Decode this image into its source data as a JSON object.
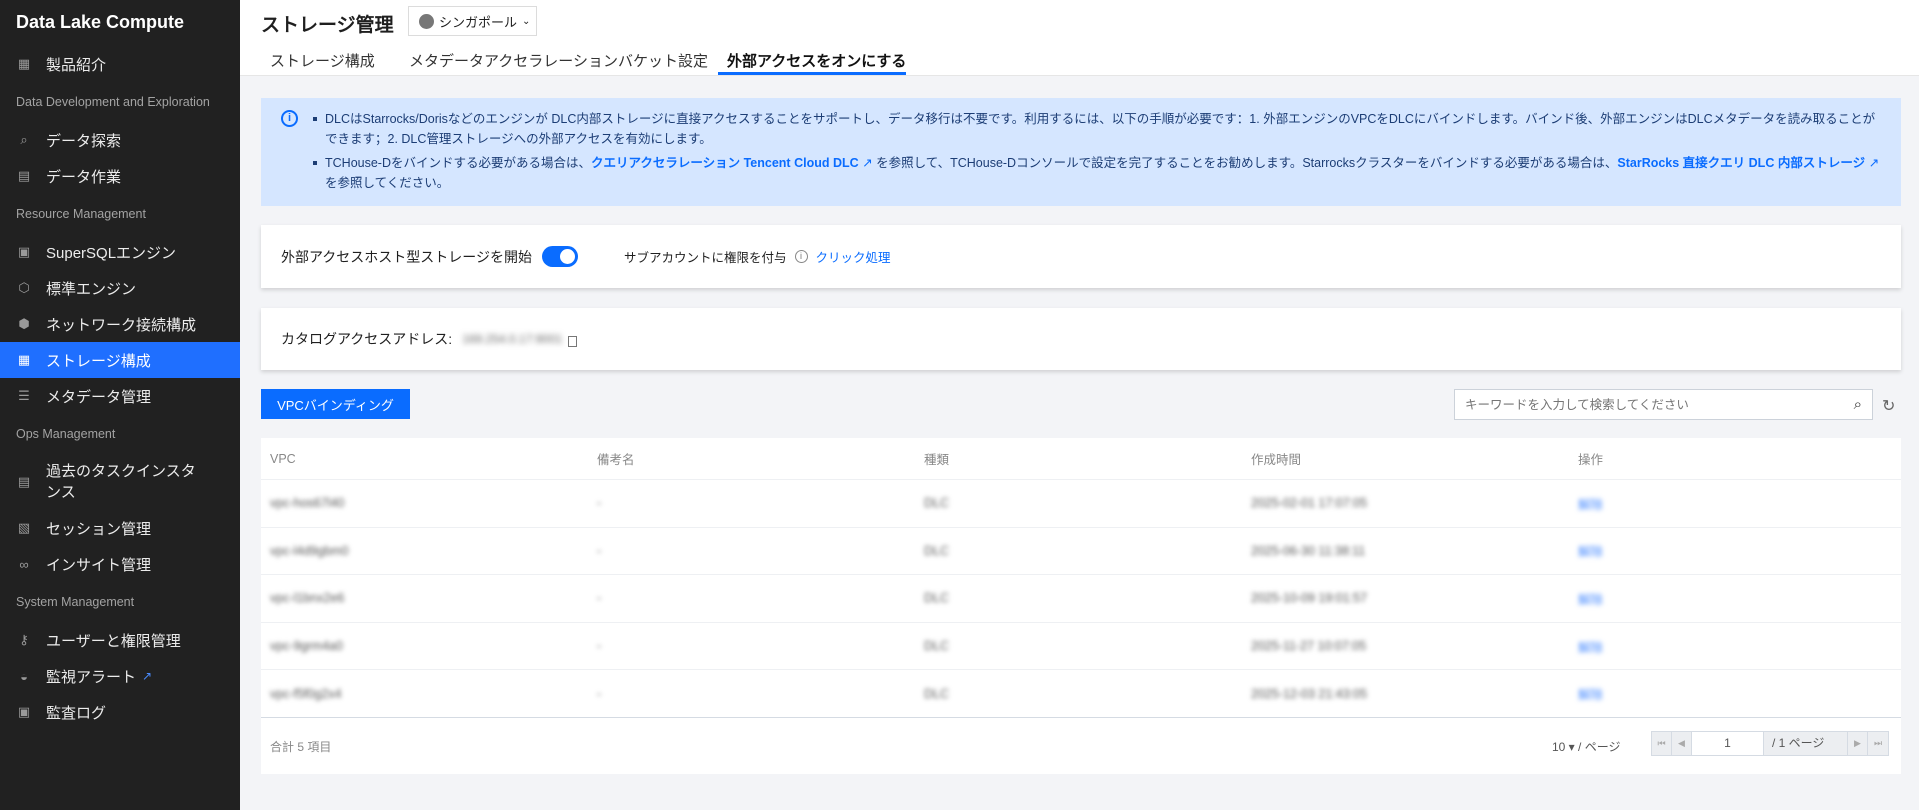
{
  "sidebar": {
    "title": "Data Lake Compute",
    "items": [
      {
        "label": "製品紹介"
      },
      {
        "section": "Data Development and Exploration"
      },
      {
        "label": "データ探索"
      },
      {
        "label": "データ作業"
      },
      {
        "section": "Resource Management"
      },
      {
        "label": "SuperSQLエンジン"
      },
      {
        "label": "標準エンジン"
      },
      {
        "label": "ネットワーク接続構成"
      },
      {
        "label": "ストレージ構成",
        "active": true
      },
      {
        "label": "メタデータ管理"
      },
      {
        "section": "Ops Management"
      },
      {
        "label": "過去のタスクインスタンス"
      },
      {
        "label": "セッション管理"
      },
      {
        "label": "インサイト管理"
      },
      {
        "section": "System Management"
      },
      {
        "label": "ユーザーと権限管理"
      },
      {
        "label": "監視アラート"
      },
      {
        "label": "監査ログ"
      }
    ]
  },
  "header": {
    "title": "ストレージ管理",
    "region": "シンガポール",
    "tabs": [
      "ストレージ構成",
      "メタデータアクセラレーションバケット設定",
      "外部アクセスをオンにする"
    ]
  },
  "alert": {
    "line1": "DLCはStarrocks/Dorisなどのエンジンが DLC内部ストレージに直接アクセスすることをサポートし、データ移行は不要です。利用するには、以下の手順が必要です：1. 外部エンジンのVPCをDLCにバインドします。バインド後、外部エンジンはDLCメタデータを読み取ることができます；2. DLC管理ストレージへの外部アクセスを有効にします。",
    "line2a": "TCHouse-Dをバインドする必要がある場合は、",
    "link1": "クエリアクセラレーション Tencent Cloud DLC",
    "line2b": "を参照して、TCHouse-Dコンソールで設定を完了することをお勧めします。Starrocksクラスターをバインドする必要がある場合は、",
    "link2": "StarRocks 直接クエリ DLC 内部ストレージ",
    "line2c": "を参照してください。"
  },
  "access": {
    "label": "外部アクセスホスト型ストレージを開始",
    "enabled": true,
    "sub_label": "サブアカウントに権限を付与",
    "sub_link": "クリック処理"
  },
  "catalog": {
    "label": "カタログアクセスアドレス:",
    "value": "169.254.0.17:9001"
  },
  "toolbar": {
    "bind_button": "VPCバインディング",
    "search_placeholder": "キーワードを入力して検索してください"
  },
  "table": {
    "columns": [
      "VPC",
      "備考名",
      "種類",
      "作成時間",
      "操作"
    ],
    "rows": [
      [
        "vpc-hos67l40",
        "-",
        "DLC",
        "2025-02-01 17:07:05",
        "解除"
      ],
      [
        "vpc-l4d9gbm0",
        "-",
        "DLC",
        "2025-06-30 11:38:11",
        "解除"
      ],
      [
        "vpc-l1bnx2e6",
        "-",
        "DLC",
        "2025-10-09 19:01:57",
        "解除"
      ],
      [
        "vpc-9grm4a0",
        "-",
        "DLC",
        "2025-11-27 10:07:05",
        "解除"
      ],
      [
        "vpc-f5f0g2x4",
        "-",
        "DLC",
        "2025-12-03 21:43:05",
        "解除"
      ]
    ],
    "total": "合計 5 項目",
    "page_size": "10 ▾ / ページ",
    "page": "1",
    "total_pages": "/ 1 ページ"
  }
}
